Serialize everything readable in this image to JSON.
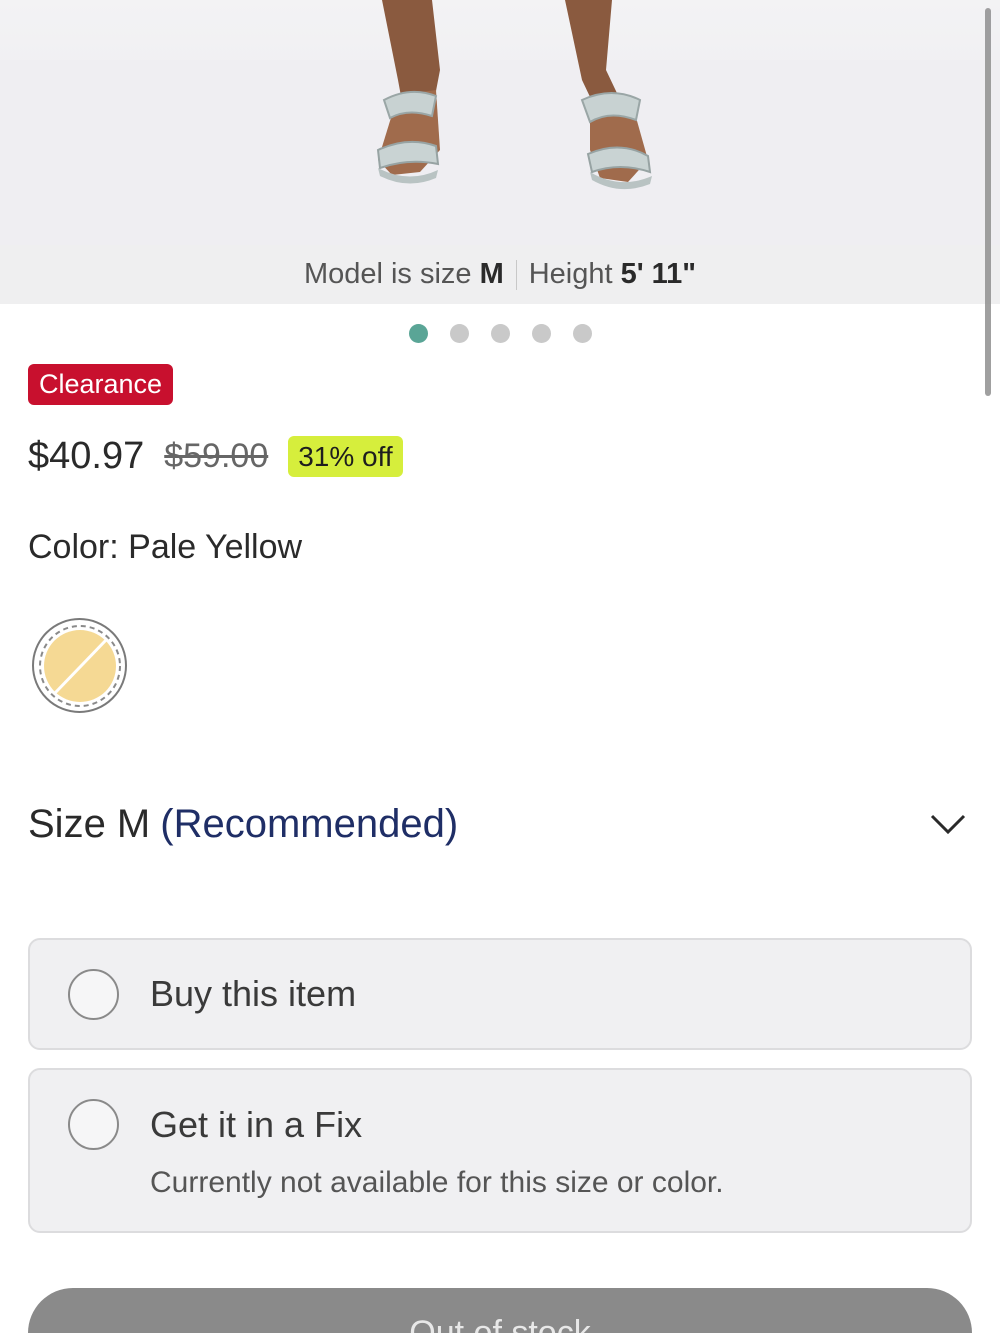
{
  "photo": {
    "caption_prefix": "Model is size",
    "model_size": "M",
    "caption_height_label": "Height",
    "model_height": "5' 11\""
  },
  "carousel": {
    "count": 5,
    "active_index": 0
  },
  "product": {
    "badge": "Clearance",
    "price": "$40.97",
    "original_price": "$59.00",
    "discount": "31% off"
  },
  "color": {
    "label": "Color:",
    "value": "Pale Yellow",
    "swatch_hex": "#f5d994"
  },
  "size": {
    "label": "Size M",
    "recommended": "(Recommended)"
  },
  "options": {
    "buy": {
      "title": "Buy this item"
    },
    "fix": {
      "title": "Get it in a Fix",
      "subtitle": "Currently not available for this size or color."
    }
  },
  "cta": {
    "label": "Out of stock"
  },
  "colors": {
    "clearance_red": "#c8102e",
    "discount_lime": "#d6ee3c",
    "recommended_navy": "#1f2e66",
    "active_dot": "#5aa596"
  }
}
